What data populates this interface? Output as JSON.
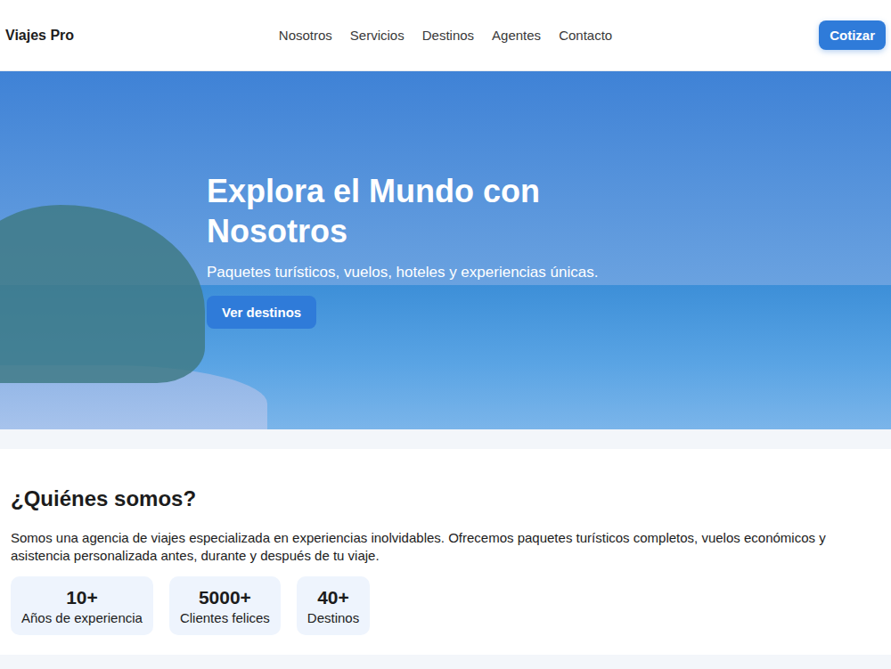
{
  "header": {
    "brand": "Viajes Pro",
    "nav": [
      "Nosotros",
      "Servicios",
      "Destinos",
      "Agentes",
      "Contacto"
    ],
    "cta": "Cotizar"
  },
  "hero": {
    "title": "Explora el Mundo con Nosotros",
    "subtitle": "Paquetes turísticos, vuelos, hoteles y experiencias únicas.",
    "button": "Ver destinos"
  },
  "about": {
    "title": "¿Quiénes somos?",
    "text": "Somos una agencia de viajes especializada en experiencias inolvidables. Ofrecemos paquetes turísticos completos, vuelos económicos y asistencia personalizada antes, durante y después de tu viaje.",
    "stats": [
      {
        "value": "10+",
        "label": "Años de experiencia"
      },
      {
        "value": "5000+",
        "label": "Clientes felices"
      },
      {
        "value": "40+",
        "label": "Destinos"
      }
    ]
  }
}
